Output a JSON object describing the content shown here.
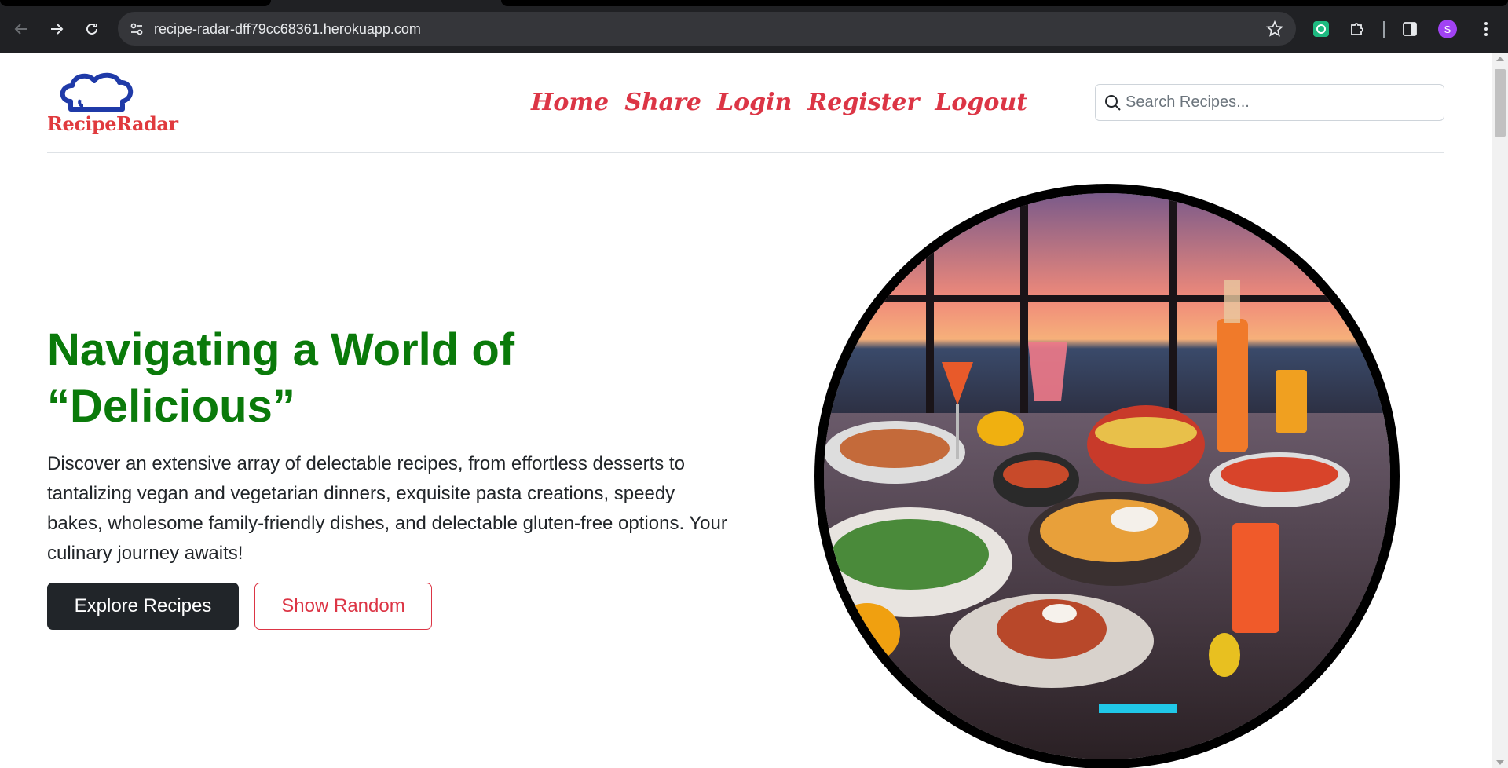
{
  "browser": {
    "url": "recipe-radar-dff79cc68361.herokuapp.com",
    "profile_initial": "S"
  },
  "site": {
    "logo_text": "RecipeRadar",
    "nav": [
      "Home",
      "Share",
      "Login",
      "Register",
      "Logout"
    ],
    "search_placeholder": "Search Recipes..."
  },
  "hero": {
    "title_line1": "Navigating a World of",
    "title_line2": "“Delicious”",
    "description": "Discover an extensive array of delectable recipes, from effortless desserts to tantalizing vegan and vegetarian dinners, exquisite pasta creations, speedy bakes, wholesome family-friendly dishes, and delectable gluten-free options. Your culinary journey awaits!",
    "primary_button": "Explore Recipes",
    "secondary_button": "Show Random"
  },
  "colors": {
    "brand_red": "#dc3545",
    "title_green": "#0a7a0a",
    "dark_button": "#212529"
  }
}
